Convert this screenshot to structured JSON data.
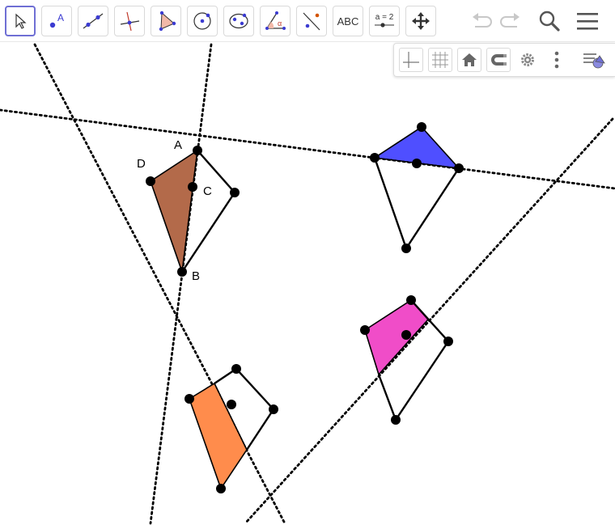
{
  "toolbar": {
    "tools": [
      {
        "id": "move",
        "icon": "move-arrow-icon",
        "selected": true
      },
      {
        "id": "point",
        "icon": "point-icon",
        "label": "A"
      },
      {
        "id": "line",
        "icon": "line-through-points-icon"
      },
      {
        "id": "perpendicular",
        "icon": "perpendicular-line-icon"
      },
      {
        "id": "polygon",
        "icon": "polygon-icon"
      },
      {
        "id": "circle",
        "icon": "circle-center-point-icon"
      },
      {
        "id": "ellipse",
        "icon": "ellipse-icon"
      },
      {
        "id": "angle",
        "icon": "angle-icon",
        "label": "α"
      },
      {
        "id": "reflect",
        "icon": "reflect-about-line-icon"
      },
      {
        "id": "text",
        "icon": "text-icon",
        "label": "ABC"
      },
      {
        "id": "slider",
        "icon": "slider-icon",
        "label": "a = 2"
      },
      {
        "id": "move-graphics",
        "icon": "move-graphics-view-icon"
      }
    ],
    "right": [
      "undo-icon",
      "redo-icon",
      "search-icon",
      "menu-icon"
    ]
  },
  "stylebar": {
    "buttons": [
      "axes-icon",
      "grid-icon",
      "home-icon",
      "snap-magnet-icon",
      "settings-gear-icon",
      "more-vertical-icon",
      "style-bar-toggle-icon"
    ]
  },
  "canvas": {
    "labels": {
      "A": "A",
      "B": "B",
      "C": "C",
      "D": "D"
    },
    "colors": {
      "brown": "#b36a4a",
      "blue": "#4f4fff",
      "magenta": "#f04dc8",
      "orange": "#ff8c4c",
      "line": "#000000"
    }
  }
}
